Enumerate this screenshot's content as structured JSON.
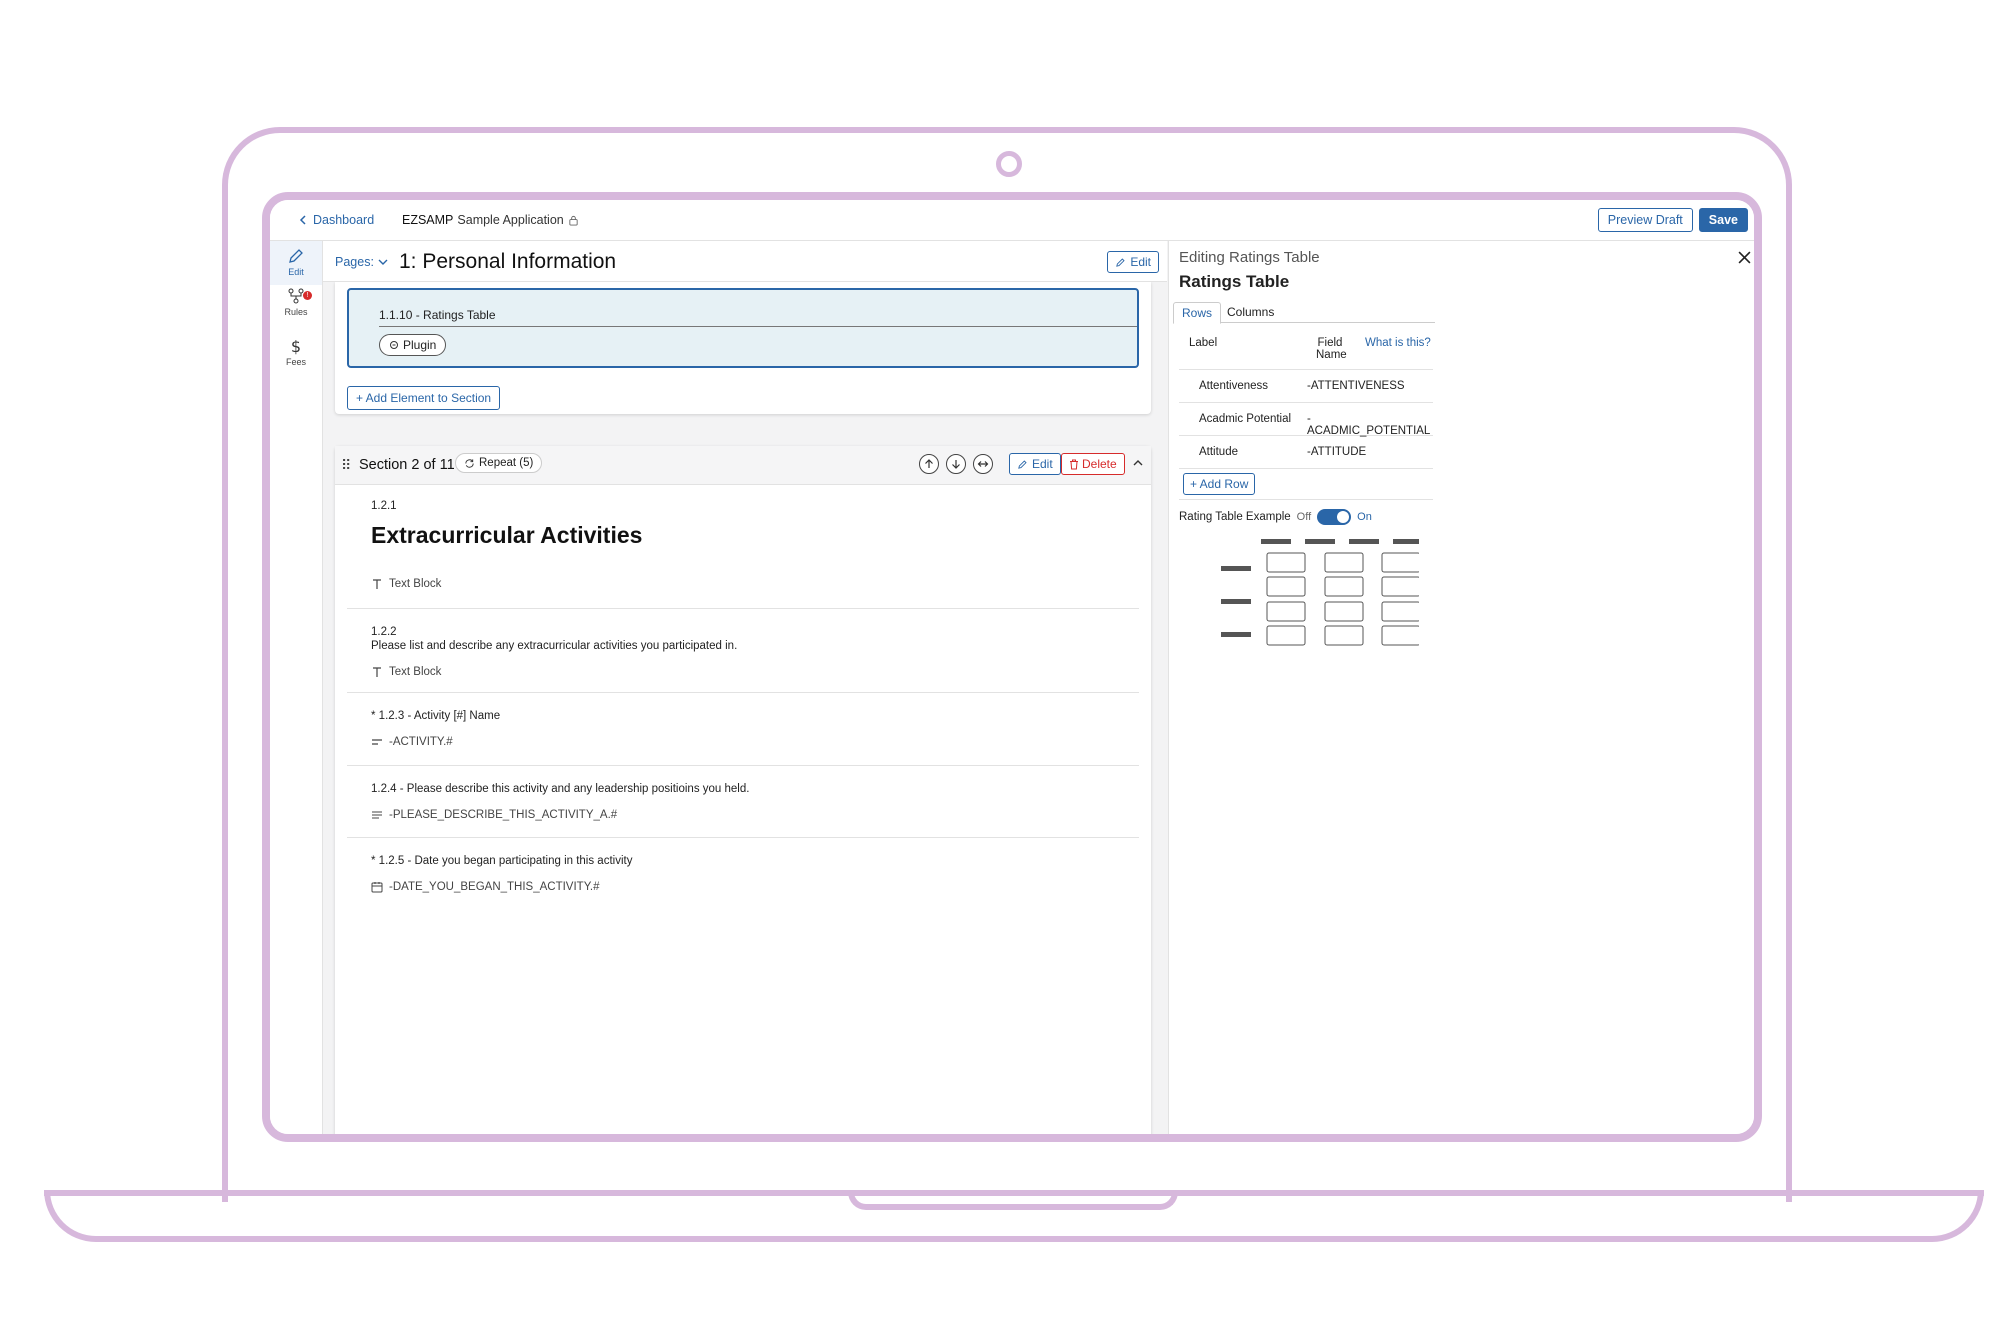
{
  "topbar": {
    "back_label": "Dashboard",
    "app_code": "EZSAMP",
    "app_name": "Sample Application",
    "preview_label": "Preview Draft",
    "save_label": "Save"
  },
  "leftnav": [
    {
      "label": "Edit",
      "icon": "pencil-icon"
    },
    {
      "label": "Rules",
      "icon": "rules-icon",
      "badge": "!"
    },
    {
      "label": "Fees",
      "icon": "dollar-icon"
    }
  ],
  "page_header": {
    "pages_label": "Pages:",
    "title": "1: Personal Information",
    "edit_label": "Edit"
  },
  "section1": {
    "selected_element": "1.1.10 - Ratings Table",
    "plugin_label": "Plugin",
    "add_element_label": "+ Add Element to Section"
  },
  "section2": {
    "title": "Section 2 of 11",
    "repeat_label": "Repeat (5)",
    "edit_label": "Edit",
    "delete_label": "Delete",
    "elements": [
      {
        "number": "1.2.1",
        "heading": "Extracurricular Activities",
        "meta": "Text Block"
      },
      {
        "number": "1.2.2",
        "text": "Please list and describe any extracurricular activities you participated in.",
        "meta": "Text Block"
      },
      {
        "label": "* 1.2.3 - Activity [#] Name",
        "meta": "-ACTIVITY.#"
      },
      {
        "label": "1.2.4 - Please describe this activity and any leadership positioins you held.",
        "meta": "-PLEASE_DESCRIBE_THIS_ACTIVITY_A.#"
      },
      {
        "label": "* 1.2.5 - Date you began participating in this activity",
        "meta": "-DATE_YOU_BEGAN_THIS_ACTIVITY.#"
      }
    ]
  },
  "right_panel": {
    "subtitle": "Editing Ratings Table",
    "title": "Ratings Table",
    "tabs": [
      "Rows",
      "Columns"
    ],
    "headers": {
      "label": "Label",
      "field": "Field Name",
      "help": "What is this?"
    },
    "rows": [
      {
        "label": "Attentiveness",
        "field": "-ATTENTIVENESS"
      },
      {
        "label": "Acadmic Potential",
        "field": "-ACADMIC_POTENTIAL"
      },
      {
        "label": "Attitude",
        "field": "-ATTITUDE"
      }
    ],
    "add_row_label": "+ Add Row",
    "toggle_label": "Rating Table Example",
    "toggle_off": "Off",
    "toggle_on": "On",
    "toggle_state": "on"
  },
  "colors": {
    "accent": "#2a66a8",
    "danger": "#d62b2b",
    "frame": "#d7b8dc",
    "selected_bg": "#e6f1f5"
  }
}
